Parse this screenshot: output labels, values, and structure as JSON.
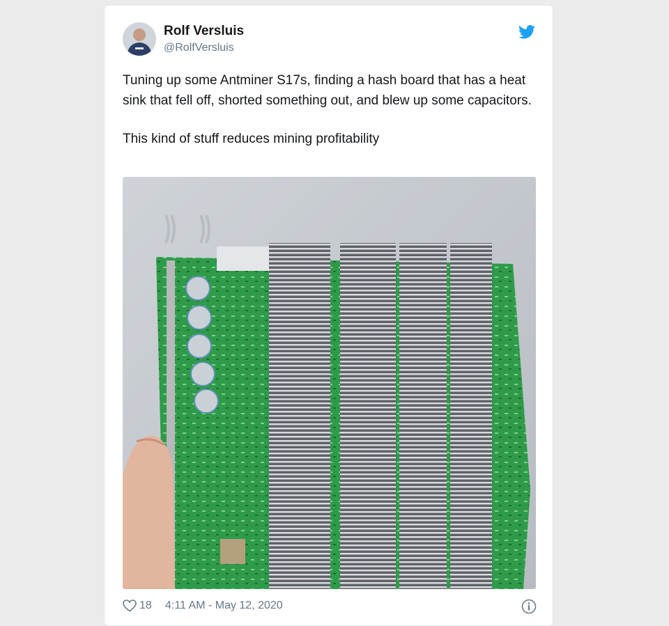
{
  "tweet": {
    "author_name": "Rolf Versluis",
    "author_handle": "@RolfVersluis",
    "text_paragraph_1": "Tuning up some Antminer S17s, finding a hash board that has a heat sink that fell off, shorted something out, and blew up some capacitors.",
    "text_paragraph_2": "This kind of stuff reduces mining profitability",
    "likes": "18",
    "timestamp": "4:11 AM - May 12, 2020"
  },
  "icons": {
    "brand": "twitter-bird-icon",
    "like": "heart-icon",
    "info": "info-icon"
  },
  "colors": {
    "twitter_blue": "#1da1f2",
    "text_primary": "#14171a",
    "text_secondary": "#657786",
    "card_border": "#e1e8ed",
    "board_green": "#2f9b4a"
  }
}
